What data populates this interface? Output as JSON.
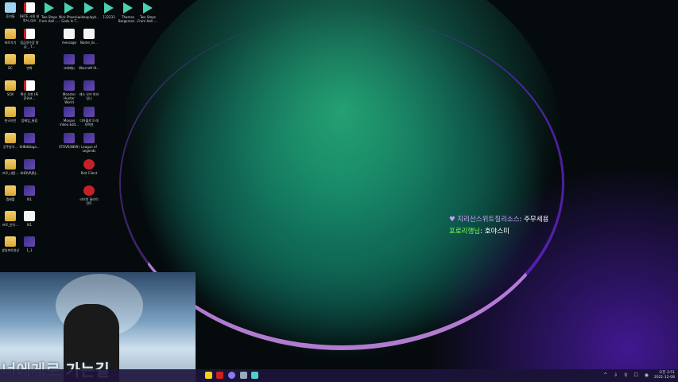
{
  "desktop": {
    "icons": [
      {
        "label": "휴지통",
        "type": "bin"
      },
      {
        "label": "[HITE 사용 설명서_cpo",
        "type": "pdf"
      },
      {
        "label": "Two Steps From Hell -...",
        "type": "mp3"
      },
      {
        "label": "Nick Phoenix - Gods In T...",
        "type": "mp3"
      },
      {
        "label": "videoplayb...",
        "type": "mp3"
      },
      {
        "label": "112233",
        "type": "mp3"
      },
      {
        "label": "Thomas Bergersen...",
        "type": "mp3"
      },
      {
        "label": "Two Steps From Hell -...",
        "type": "mp3"
      },
      {
        "label": "바로가기",
        "type": "folder"
      },
      {
        "label": "접금영수증 발급 _ T...",
        "type": "pdf"
      },
      {
        "label": "message",
        "type": "file"
      },
      {
        "label": "Name_lis...",
        "type": "file"
      },
      {
        "label": "DC",
        "type": "folder"
      },
      {
        "label": "변화",
        "type": "folder"
      },
      {
        "label": "고래메뉴",
        "type": "app"
      },
      {
        "label": "Warcraft III...",
        "type": "app"
      },
      {
        "label": "SOX",
        "type": "folder"
      },
      {
        "label": "확산 추천 (특준위코...",
        "type": "pdf"
      },
      {
        "label": "Monster Hunter World",
        "type": "app"
      },
      {
        "label": "레스 오브 마라입니",
        "type": "app"
      },
      {
        "label": "한국의전",
        "type": "folder"
      },
      {
        "label": "탐배입_통합",
        "type": "img"
      },
      {
        "label": "Movavi Video Edit...",
        "type": "app"
      },
      {
        "label": "디아블로 II 레저렉션",
        "type": "app"
      },
      {
        "label": "공주방치...",
        "type": "folder"
      },
      {
        "label": "SHBd&bga...",
        "type": "img"
      },
      {
        "label": "STOVE(NEW)",
        "type": "app"
      },
      {
        "label": "League of Legends",
        "type": "app"
      },
      {
        "label": "프로_내용...",
        "type": "folder"
      },
      {
        "label": "AHDVRJRJ...",
        "type": "img"
      },
      {
        "label": "Riot Client",
        "type": "red"
      },
      {
        "label": "겜배틀",
        "type": "folder"
      },
      {
        "label": "III1",
        "type": "img"
      },
      {
        "label": "라이엇 클라이언트",
        "type": "red"
      },
      {
        "label": "프로_반다...",
        "type": "folder"
      },
      {
        "label": "III1",
        "type": "file"
      },
      {
        "label": "생일축하영상",
        "type": "folder"
      },
      {
        "label": "1_1",
        "type": "img"
      }
    ]
  },
  "chat": {
    "messages": [
      {
        "user": "지리산스위트칠리소스",
        "sep": ": ",
        "text": "주무세용",
        "user_color": "#c9a0ff"
      },
      {
        "user": "포로리행님",
        "sep": ": ",
        "text": "호야스미",
        "user_color": "#7dff5a"
      }
    ]
  },
  "webcam": {
    "caption": "너에게로 가는길"
  },
  "taskbar": {
    "tray": "^ ⇩ ⚲ ☐ ◉",
    "time": "오전 3:51",
    "date": "2021-12-08"
  }
}
